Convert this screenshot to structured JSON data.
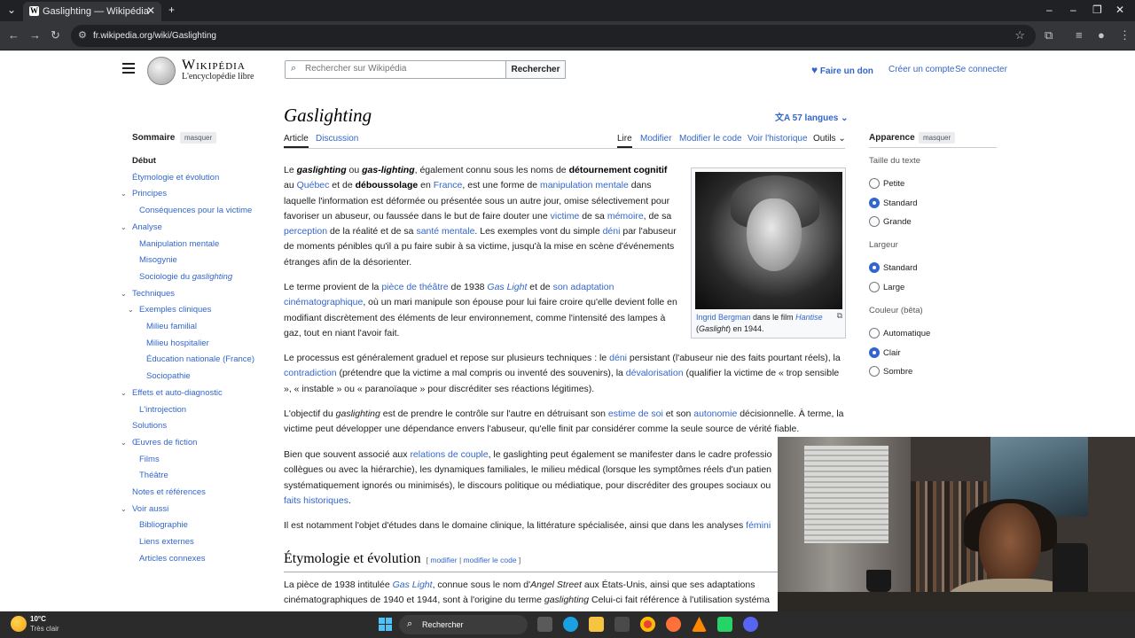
{
  "browser": {
    "tab_title": "Gaslighting — Wikipédia",
    "tab_favicon": "W",
    "url": "fr.wikipedia.org/wiki/Gaslighting"
  },
  "header": {
    "wordmark": "Wikipédia",
    "tagline": "L'encyclopédie libre",
    "search_placeholder": "Rechercher sur Wikipédia",
    "search_button": "Rechercher",
    "donate": "Faire un don",
    "create_account": "Créer un compte",
    "login": "Se connecter"
  },
  "toc": {
    "title": "Sommaire",
    "hide": "masquer",
    "items": [
      {
        "label": "Début",
        "level": 0,
        "active": true
      },
      {
        "label": "Étymologie et évolution",
        "level": 0
      },
      {
        "label": "Principes",
        "level": 0,
        "expandable": true
      },
      {
        "label": "Conséquences pour la victime",
        "level": 1
      },
      {
        "label": "Analyse",
        "level": 0,
        "expandable": true
      },
      {
        "label": "Manipulation mentale",
        "level": 1
      },
      {
        "label": "Misogynie",
        "level": 1
      },
      {
        "label": "Sociologie du ",
        "label_em": "gaslighting",
        "level": 1
      },
      {
        "label": "Techniques",
        "level": 0,
        "expandable": true
      },
      {
        "label": "Exemples cliniques",
        "level": 1,
        "expandable": true
      },
      {
        "label": "Milieu familial",
        "level": 2
      },
      {
        "label": "Milieu hospitalier",
        "level": 2
      },
      {
        "label": "Éducation nationale (France)",
        "level": 2
      },
      {
        "label": "Sociopathie",
        "level": 2
      },
      {
        "label": "Effets et auto-diagnostic",
        "level": 0,
        "expandable": true
      },
      {
        "label": "L'introjection",
        "level": 1
      },
      {
        "label": "Solutions",
        "level": 0
      },
      {
        "label": "Œuvres de fiction",
        "level": 0,
        "expandable": true
      },
      {
        "label": "Films",
        "level": 1
      },
      {
        "label": "Théâtre",
        "level": 1
      },
      {
        "label": "Notes et références",
        "level": 0
      },
      {
        "label": "Voir aussi",
        "level": 0,
        "expandable": true
      },
      {
        "label": "Bibliographie",
        "level": 1
      },
      {
        "label": "Liens externes",
        "level": 1
      },
      {
        "label": "Articles connexes",
        "level": 1
      }
    ]
  },
  "article": {
    "title": "Gaslighting",
    "languages": "57 langues",
    "tabs_left": [
      "Article",
      "Discussion"
    ],
    "tabs_right": [
      "Lire",
      "Modifier",
      "Modifier le code",
      "Voir l'historique",
      "Outils"
    ],
    "section_heading": "Étymologie et évolution",
    "section_edit": "modifier",
    "section_edit_code": "modifier le code"
  },
  "figure": {
    "caption_link": "Ingrid Bergman",
    "caption_mid": " dans le film ",
    "caption_film": "Hantise",
    "caption_paren_open": " (",
    "caption_original": "Gaslight",
    "caption_end": ") en 1944."
  },
  "appearance": {
    "title": "Apparence",
    "hide": "masquer",
    "text_size_label": "Taille du texte",
    "text_size_options": [
      "Petite",
      "Standard",
      "Grande"
    ],
    "text_size_selected": "Standard",
    "width_label": "Largeur",
    "width_options": [
      "Standard",
      "Large"
    ],
    "width_selected": "Standard",
    "color_label": "Couleur (bêta)",
    "color_options": [
      "Automatique",
      "Clair",
      "Sombre"
    ],
    "color_selected": "Clair"
  },
  "taskbar": {
    "temperature": "10°C",
    "weather": "Très clair",
    "search": "Rechercher"
  }
}
